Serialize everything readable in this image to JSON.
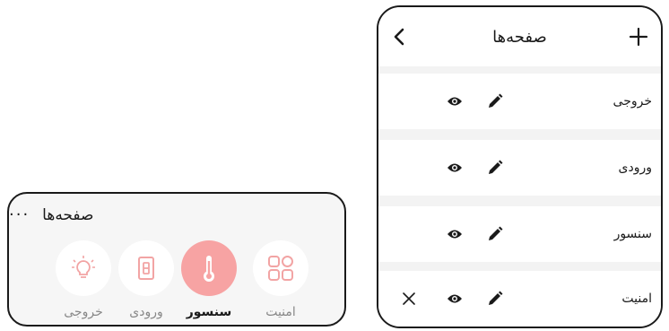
{
  "widget": {
    "title": "صفحه‌ها",
    "more": "···",
    "items": [
      {
        "label": "امنیت",
        "icon": "grid-icon",
        "active": false
      },
      {
        "label": "سنسور",
        "icon": "thermometer-icon",
        "active": true
      },
      {
        "label": "ورودی",
        "icon": "light-switch-icon",
        "active": false
      },
      {
        "label": "خروجی",
        "icon": "light-bulb-icon",
        "active": false
      }
    ]
  },
  "panel": {
    "title": "صفحه‌ها",
    "back_icon": "chevron-left-icon",
    "add_icon": "plus-icon",
    "rows": [
      {
        "label": "خروجی",
        "deletable": false
      },
      {
        "label": "ورودی",
        "deletable": false
      },
      {
        "label": "سنسور",
        "deletable": false
      },
      {
        "label": "امنیت",
        "deletable": true
      }
    ]
  },
  "colors": {
    "accent": "#f7a3a3",
    "icon_muted": "#f2a4a4",
    "text": "#1a1a1a",
    "muted_text": "#888888",
    "panel_bg": "#f3f3f3"
  }
}
